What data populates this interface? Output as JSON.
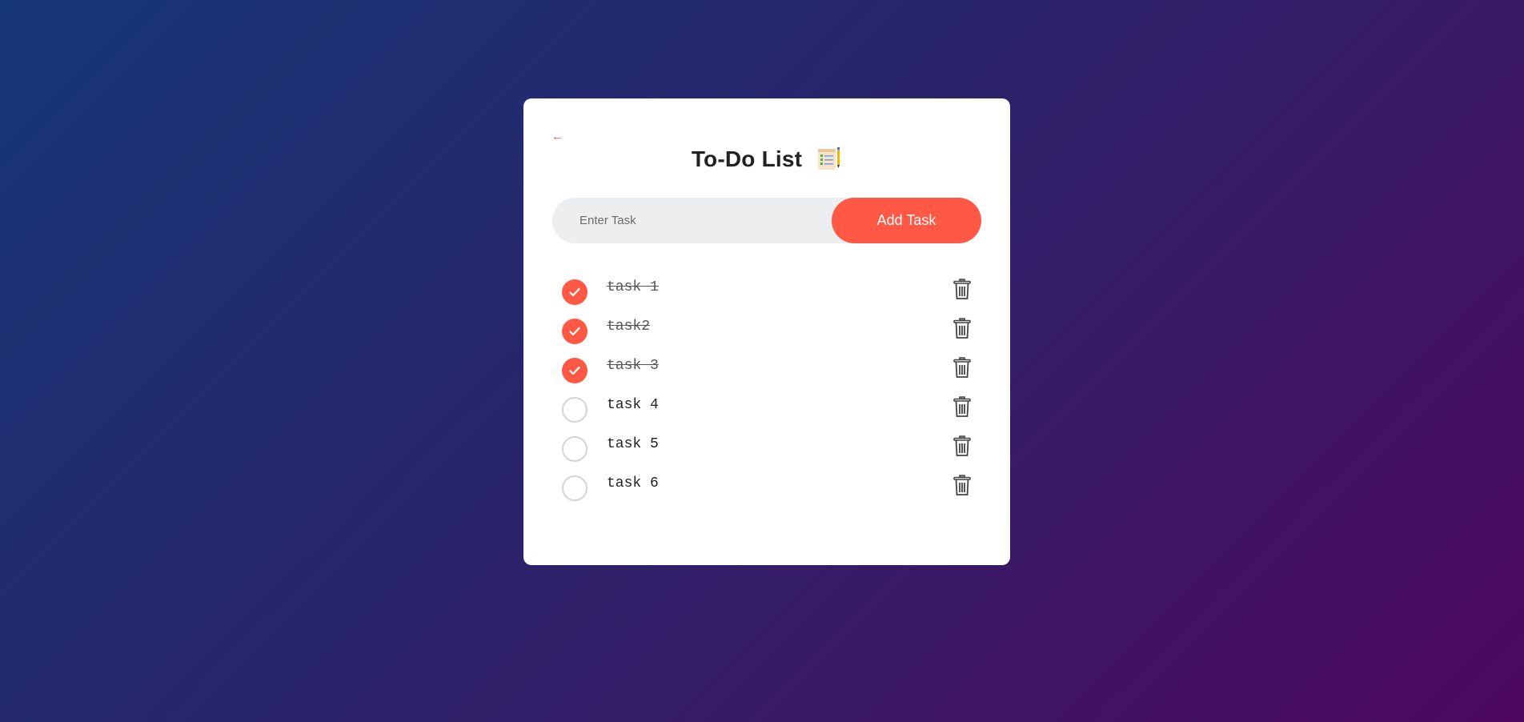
{
  "header": {
    "back_icon": "←",
    "title": "To-Do List",
    "title_icon": "checklist-notepad-icon"
  },
  "input": {
    "placeholder": "Enter Task",
    "value": "",
    "add_label": "Add Task"
  },
  "tasks": [
    {
      "text": "task 1",
      "done": true
    },
    {
      "text": "task2",
      "done": true
    },
    {
      "text": "task 3",
      "done": true
    },
    {
      "text": "task 4",
      "done": false
    },
    {
      "text": "task 5",
      "done": false
    },
    {
      "text": "task 6",
      "done": false
    }
  ],
  "colors": {
    "accent": "#ff5945",
    "background_start": "#153677",
    "background_end": "#4e085f"
  }
}
